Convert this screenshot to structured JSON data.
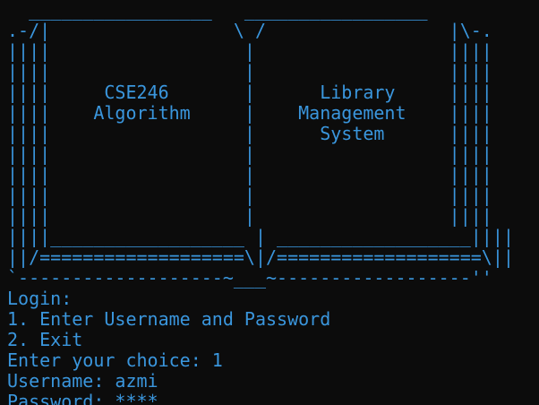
{
  "terminal": {
    "banner": [
      "  _________________   _________________",
      ".-/|                 \\ /                 |\\-.",
      "||||                  |                  ||||",
      "||||                  |                  ||||",
      "||||     CSE246       |      Library     ||||",
      "||||    Algorithm     |    Management    ||||",
      "||||                  |      System      ||||",
      "||||                  |                  ||||",
      "||||                  |                  ||||",
      "||||                  |                  ||||",
      "||||                  |                  ||||",
      "||||__________________ | __________________||||",
      "||/===================\\|/===================\\||",
      "`-------------------~___~------------------''"
    ],
    "output": [
      "Login:",
      "1. Enter Username and Password",
      "2. Exit",
      "Enter your choice: 1",
      "Username: azmi",
      "Password: ****"
    ]
  },
  "colors": {
    "background": "#0c0c0c",
    "text": "#3a96dd"
  }
}
